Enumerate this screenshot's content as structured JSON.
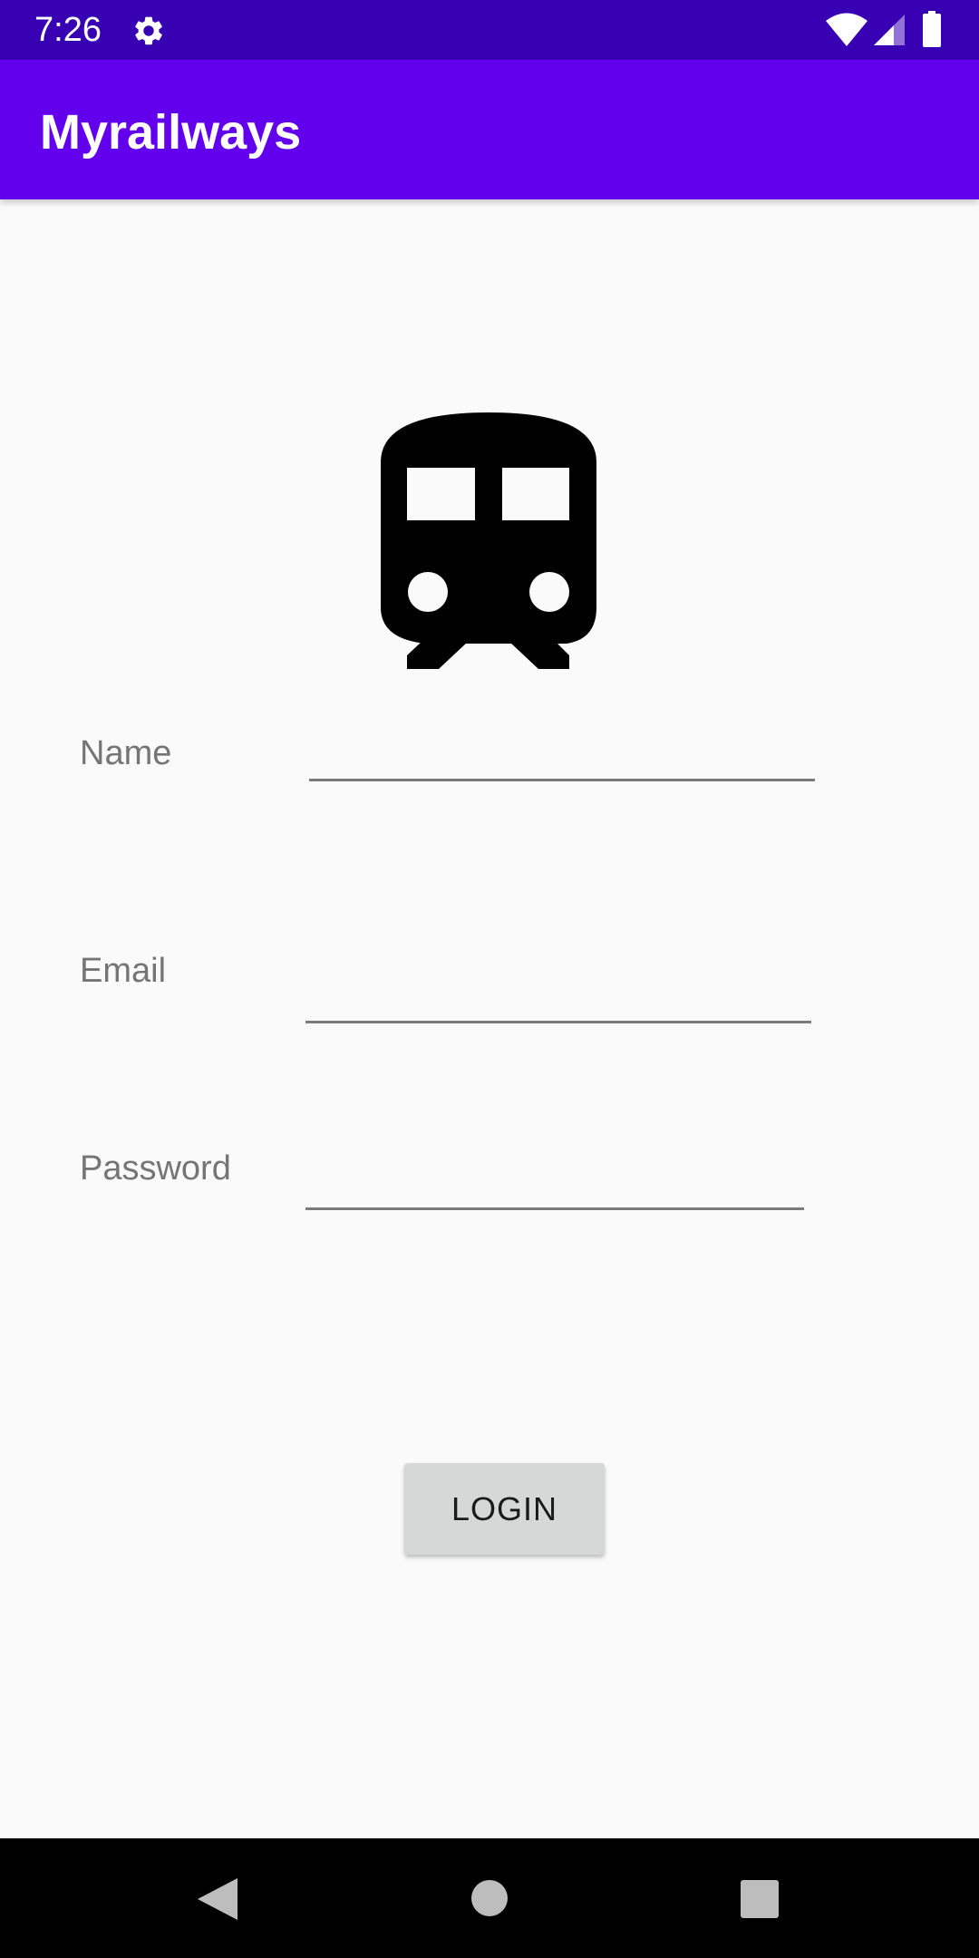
{
  "status_bar": {
    "time": "7:26",
    "icons": [
      "gear-icon",
      "wifi-icon",
      "signal-icon",
      "battery-icon"
    ]
  },
  "app_bar": {
    "title": "Myrailways",
    "color": "#6200ee"
  },
  "logo": {
    "icon": "train-icon"
  },
  "form": {
    "name_label": "Name",
    "name_value": "",
    "email_label": "Email",
    "email_value": "",
    "password_label": "Password",
    "password_value": ""
  },
  "login_button": {
    "label": "LOGIN"
  },
  "nav_bar": {
    "icons": [
      "back-icon",
      "home-icon",
      "recents-icon"
    ]
  },
  "colors": {
    "status_bar": "#3700b3",
    "app_bar": "#6200ee",
    "background": "#fafafa",
    "button": "#d6d7d7"
  }
}
